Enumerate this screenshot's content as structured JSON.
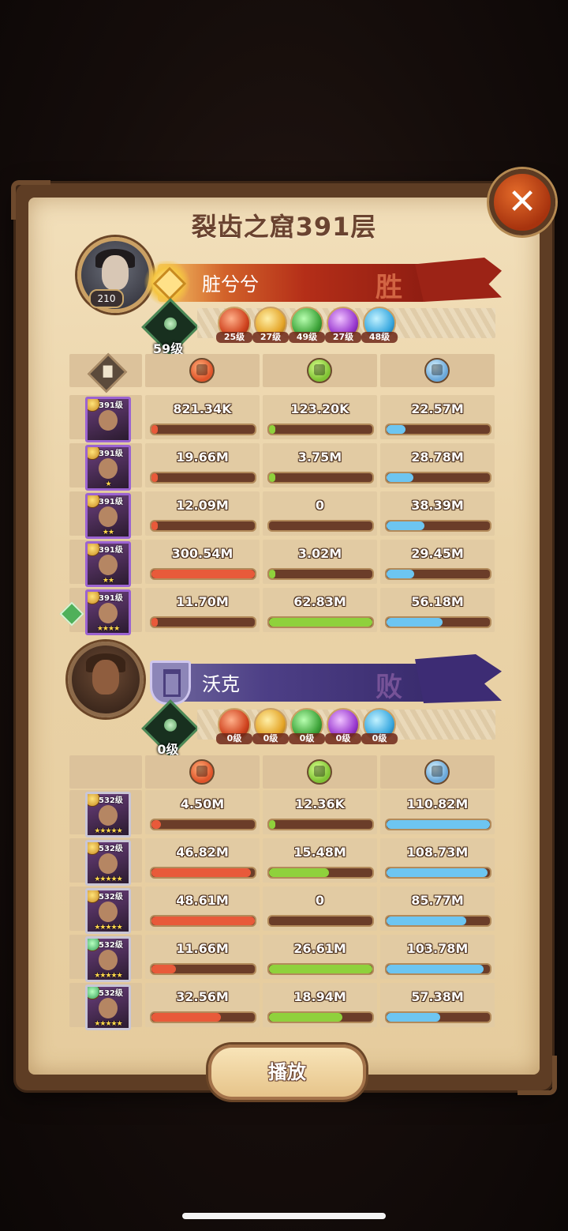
{
  "title": "裂齿之窟391层",
  "close_icon": "close-icon",
  "play_label": "播放",
  "stat_icons": [
    "damage-icon",
    "heal-icon",
    "tank-icon"
  ],
  "colors": {
    "damage": "#e85a3a",
    "heal": "#8fd13c",
    "tank": "#6dc5f1",
    "win": "#b42e18",
    "lose": "#4d3f86"
  },
  "teams": [
    {
      "player_name": "脏兮兮",
      "player_level": "210",
      "result": "胜",
      "tree_level": "59级",
      "skills": [
        {
          "icon": "fire-skill-icon",
          "level": "25级"
        },
        {
          "icon": "light-skill-icon",
          "level": "27级"
        },
        {
          "icon": "nature-skill-icon",
          "level": "49级"
        },
        {
          "icon": "void-skill-icon",
          "level": "27级"
        },
        {
          "icon": "frost-skill-icon",
          "level": "48级"
        }
      ],
      "heroes": [
        {
          "level": "391级",
          "stars": "",
          "damage": "821.34K",
          "heal": "123.20K",
          "tank": "22.57M",
          "damage_ratio": 0.003,
          "heal_ratio": 0.002,
          "tank_ratio": 0.18
        },
        {
          "level": "391级",
          "stars": "★",
          "damage": "19.66M",
          "heal": "3.75M",
          "tank": "28.78M",
          "damage_ratio": 0.06,
          "heal_ratio": 0.06,
          "tank_ratio": 0.26
        },
        {
          "level": "391级",
          "stars": "★★",
          "damage": "12.09M",
          "heal": "0",
          "tank": "38.39M",
          "damage_ratio": 0.04,
          "heal_ratio": 0,
          "tank_ratio": 0.37
        },
        {
          "level": "391级",
          "stars": "★★",
          "damage": "300.54M",
          "heal": "3.02M",
          "tank": "29.45M",
          "damage_ratio": 1.0,
          "heal_ratio": 0.05,
          "tank_ratio": 0.27
        },
        {
          "level": "391级",
          "stars": "★★★★",
          "damage": "11.70M",
          "heal": "62.83M",
          "tank": "56.18M",
          "damage_ratio": 0.04,
          "heal_ratio": 1.0,
          "tank_ratio": 0.54
        }
      ]
    },
    {
      "player_name": "沃克",
      "result": "败",
      "tree_level": "0级",
      "skills": [
        {
          "icon": "fire-skill-icon",
          "level": "0级"
        },
        {
          "icon": "light-skill-icon",
          "level": "0级"
        },
        {
          "icon": "nature-skill-icon",
          "level": "0级"
        },
        {
          "icon": "void-skill-icon",
          "level": "0级"
        },
        {
          "icon": "frost-skill-icon",
          "level": "0级"
        }
      ],
      "heroes": [
        {
          "level": "532级",
          "stars": "★★★★★",
          "damage": "4.50M",
          "heal": "12.36K",
          "tank": "110.82M",
          "damage_ratio": 0.09,
          "heal_ratio": 0.001,
          "tank_ratio": 1.0
        },
        {
          "level": "532级",
          "stars": "★★★★★",
          "damage": "46.82M",
          "heal": "15.48M",
          "tank": "108.73M",
          "damage_ratio": 0.96,
          "heal_ratio": 0.58,
          "tank_ratio": 0.98
        },
        {
          "level": "532级",
          "stars": "★★★★★",
          "damage": "48.61M",
          "heal": "0",
          "tank": "85.77M",
          "damage_ratio": 1.0,
          "heal_ratio": 0,
          "tank_ratio": 0.77
        },
        {
          "level": "532级",
          "stars": "★★★★★",
          "damage": "11.66M",
          "heal": "26.61M",
          "tank": "103.78M",
          "damage_ratio": 0.24,
          "heal_ratio": 1.0,
          "tank_ratio": 0.94
        },
        {
          "level": "532级",
          "stars": "★★★★★",
          "damage": "32.56M",
          "heal": "18.94M",
          "tank": "57.38M",
          "damage_ratio": 0.67,
          "heal_ratio": 0.71,
          "tank_ratio": 0.52
        }
      ]
    }
  ]
}
